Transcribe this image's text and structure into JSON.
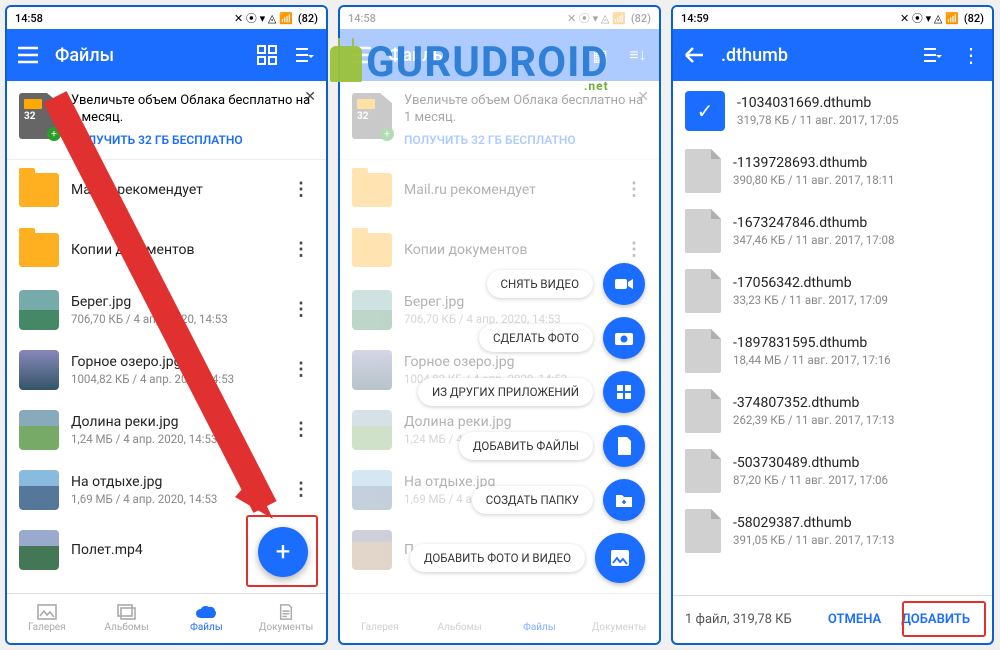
{
  "status": {
    "time": "14:58",
    "time3": "14:59",
    "battery": "82"
  },
  "s1": {
    "title": "Файлы",
    "promo_text": "Увеличьте объем Облака бесплатно на 1 месяц.",
    "promo_link": "ПОЛУЧИТЬ 32 ГБ БЕСПЛАТНО",
    "sd32": "32",
    "items": [
      {
        "name": "Mail.ru рекомендует",
        "meta": ""
      },
      {
        "name": "Копии документов",
        "meta": ""
      },
      {
        "name": "Берег.jpg",
        "meta": "706,70 КБ / 4 апр. 2020, 14:53"
      },
      {
        "name": "Горное озеро.jpg",
        "meta": "1004,82 КБ / 4 апр. 2020, 14:53"
      },
      {
        "name": "Долина реки.jpg",
        "meta": "1,24 МБ / 4 апр. 2020, 14:53"
      },
      {
        "name": "На отдыхе.jpg",
        "meta": "1,69 МБ / 4 апр. 2020, 14:53"
      },
      {
        "name": "Полет.mp4",
        "meta": ""
      }
    ],
    "tabs": [
      "Галерея",
      "Альбомы",
      "Файлы",
      "Документы"
    ]
  },
  "s2": {
    "fabmenu": [
      "СНЯТЬ ВИДЕО",
      "СДЕЛАТЬ ФОТО",
      "ИЗ ДРУГИХ ПРИЛОЖЕНИЙ",
      "ДОБАВИТЬ ФАЙЛЫ",
      "СОЗДАТЬ ПАПКУ",
      "ДОБАВИТЬ ФОТО И ВИДЕО"
    ]
  },
  "s3": {
    "title": ".dthumb",
    "items": [
      {
        "name": "-1034031669.dthumb",
        "meta": "319,78 КБ / 11 авг. 2017, 17:05",
        "sel": true
      },
      {
        "name": "-1139728693.dthumb",
        "meta": "390,80 КБ / 11 авг. 2017, 18:11"
      },
      {
        "name": "-1673247846.dthumb",
        "meta": "347,46 КБ / 11 авг. 2017, 17:08"
      },
      {
        "name": "-17056342.dthumb",
        "meta": "33,23 КБ / 11 авг. 2017, 17:09"
      },
      {
        "name": "-1897831595.dthumb",
        "meta": "18,44 МБ / 11 авг. 2017, 17:16"
      },
      {
        "name": "-374807352.dthumb",
        "meta": "262,39 КБ / 11 авг. 2017, 17:13"
      },
      {
        "name": "-503730489.dthumb",
        "meta": "87,20 КБ / 11 авг. 2017, 17:06"
      },
      {
        "name": "-58029387.dthumb",
        "meta": "391,05 КБ / 11 авг. 2017, 17:13"
      }
    ],
    "footer_info": "1 файл, 319,78 КБ",
    "cancel": "ОТМЕНА",
    "add": "ДОБАВИТЬ"
  },
  "watermark": "GURUDROID",
  "watermark_sub": ".net"
}
